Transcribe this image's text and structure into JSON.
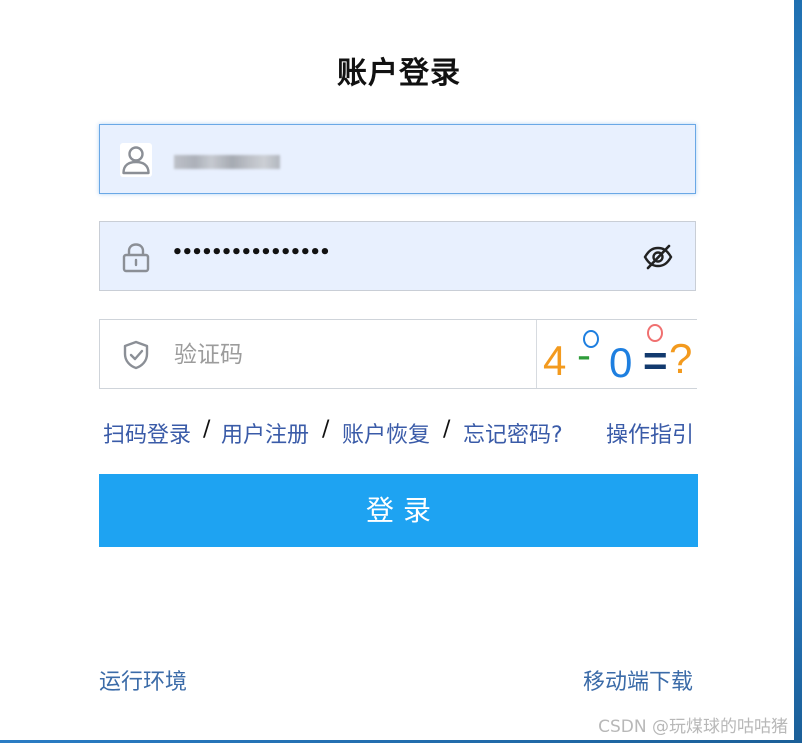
{
  "title": "账户登录",
  "username": {
    "value_masked": true
  },
  "password": {
    "masked_value": "••••••••••••••••"
  },
  "captcha": {
    "placeholder": "验证码",
    "image": {
      "chars": [
        "4",
        "-",
        "0",
        "=",
        "?"
      ],
      "colors": [
        "#f39a1e",
        "#2e9c3a",
        "#1e7fe0",
        "#123a6e",
        "#f39a1e"
      ]
    }
  },
  "links": {
    "scan_login": "扫码登录",
    "register": "用户注册",
    "recover": "账户恢复",
    "forgot": "忘记密码?",
    "guide": "操作指引",
    "separator": "/"
  },
  "login_button": "登 录",
  "footer": {
    "env": "运行环境",
    "mobile_download": "移动端下载"
  },
  "watermark": "CSDN @玩煤球的咕咕猪",
  "colors": {
    "primary_button": "#1ea3f2",
    "link": "#3a5ba8",
    "input_bg": "#e8f0fe"
  }
}
